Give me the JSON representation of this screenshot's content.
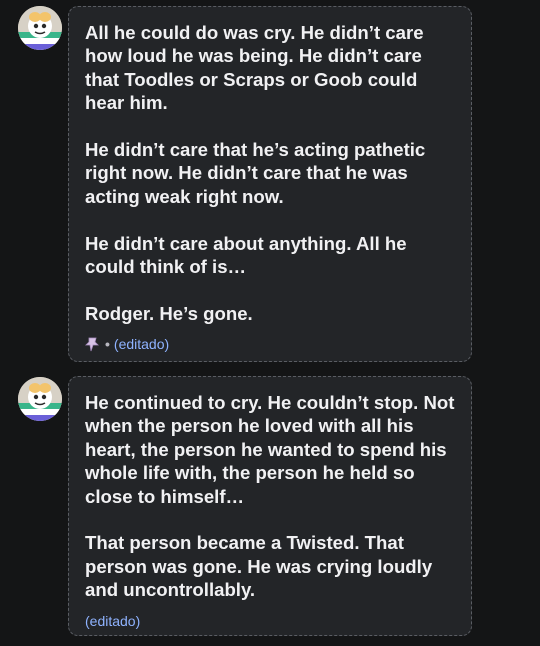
{
  "messages": [
    {
      "paragraphs": [
        "All he could do was cry. He didn’t care how loud he was being. He didn’t care that Toodles or Scraps or Goob could hear him.",
        "He didn’t care that he’s acting pathetic right now. He didn’t care that he was acting weak right now.",
        "He didn’t care about anything. All he could think of is…",
        "Rodger. He’s gone."
      ],
      "separator": "•",
      "edited_label": "(editado)",
      "icon": "pin-icon"
    },
    {
      "paragraphs": [
        "He continued to cry. He couldn’t stop. Not when the person he loved with all his heart, the person he wanted to spend his whole life with, the person he held so close to himself…",
        "That person became a Twisted. That person was gone. He was crying loudly and uncontrollably."
      ],
      "edited_label": "(editado)"
    }
  ],
  "colors": {
    "background": "#141516",
    "bubble": "#232528",
    "text": "#f1f1f3",
    "link": "#8fb3ff"
  }
}
